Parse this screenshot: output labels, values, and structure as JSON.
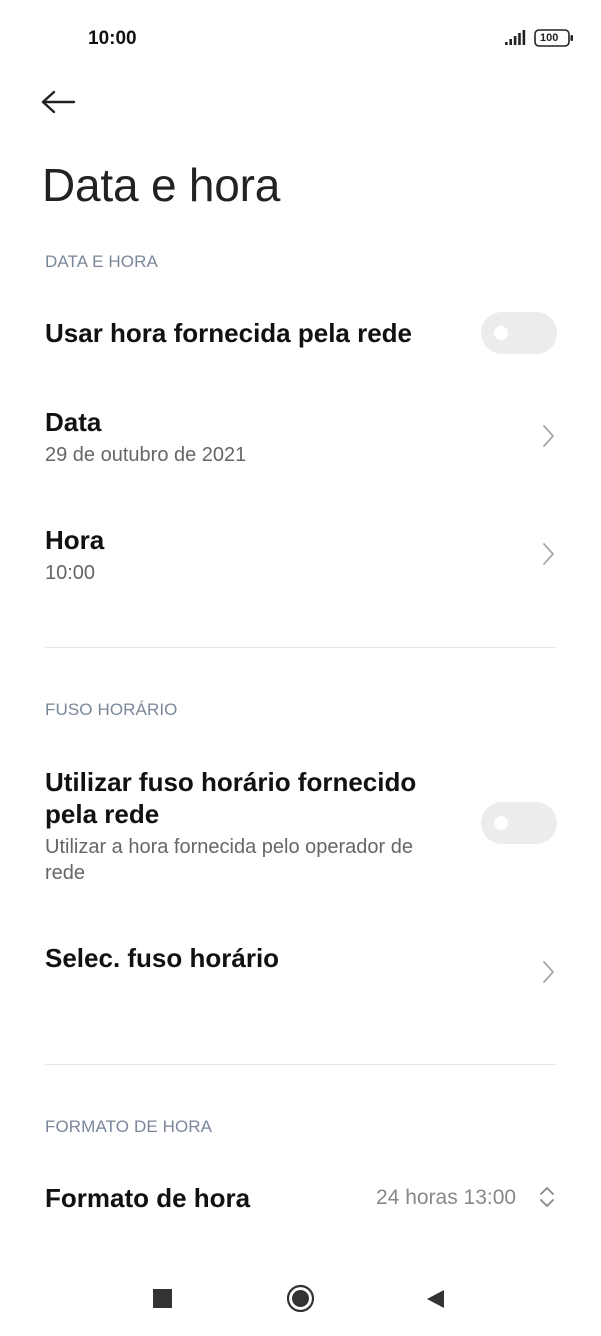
{
  "status_bar": {
    "time": "10:00",
    "battery": "100",
    "icons": [
      "signal-icon",
      "battery-icon"
    ]
  },
  "header": {
    "back_icon": "arrow-left-icon",
    "title": "Data e hora"
  },
  "sections": {
    "date_time": {
      "header": "DATA E HORA",
      "network_time": {
        "title": "Usar hora fornecida pela rede",
        "enabled": false
      },
      "date": {
        "title": "Data",
        "value": "29 de outubro de 2021"
      },
      "time": {
        "title": "Hora",
        "value": "10:00"
      }
    },
    "timezone": {
      "header": "FUSO HORÁRIO",
      "network_tz": {
        "title_line1": "Utilizar fuso horário fornecido",
        "title_line2": "pela rede",
        "subtitle_line1": "Utilizar a hora fornecida pelo operador de",
        "subtitle_line2": "rede",
        "enabled": false
      },
      "select_tz": {
        "title": "Selec. fuso horário"
      }
    },
    "time_format": {
      "header": "FORMATO DE HORA",
      "format": {
        "title": "Formato de hora",
        "value": "24 horas 13:00"
      }
    }
  },
  "nav_bar": {
    "icons": [
      "recents-icon",
      "home-icon",
      "back-triangle-icon"
    ]
  },
  "colors": {
    "section_header": "#7a869a",
    "toggle_off": "#ececec",
    "divider": "#e6e6e6"
  }
}
